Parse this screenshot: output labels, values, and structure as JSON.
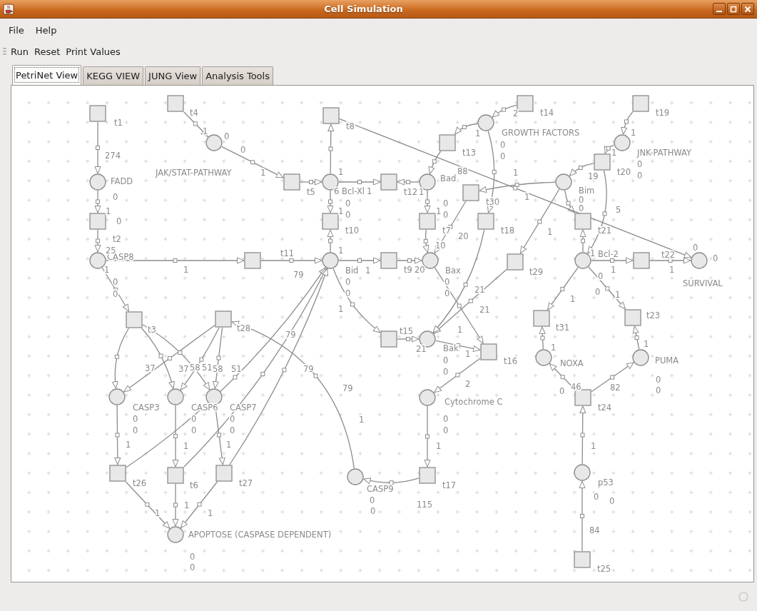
{
  "window": {
    "title": "Cell Simulation"
  },
  "menu": [
    "File",
    "Help"
  ],
  "toolbar": [
    "Run",
    "Reset",
    "Print Values"
  ],
  "tabs": [
    {
      "label": "PetriNet View",
      "selected": true
    },
    {
      "label": "KEGG VIEW",
      "selected": false
    },
    {
      "label": "JUNG View",
      "selected": false
    },
    {
      "label": "Analysis Tools",
      "selected": false
    }
  ],
  "petri_net": {
    "places": [
      {
        "name": "FADD",
        "tokens": [
          "0",
          "0"
        ]
      },
      {
        "name": "JAK/STAT-PATHWAY",
        "tokens": [
          "0",
          "0"
        ]
      },
      {
        "name": "CASP8",
        "tokens": [
          "0",
          "0"
        ]
      },
      {
        "name": "Bcl-Xl",
        "tokens": [
          "0",
          "0"
        ]
      },
      {
        "name": "Bad",
        "tokens": [
          "0",
          "0"
        ]
      },
      {
        "name": "GROWTH FACTORS",
        "tokens": [
          "0",
          "0"
        ]
      },
      {
        "name": "Bid",
        "tokens": [
          "0",
          "0"
        ]
      },
      {
        "name": "Bax",
        "tokens": [
          "0",
          "0"
        ]
      },
      {
        "name": "JNK-PATHWAY",
        "tokens": [
          "0",
          "0"
        ]
      },
      {
        "name": "Bim",
        "tokens": [
          "0",
          "0"
        ]
      },
      {
        "name": "Bcl-2",
        "tokens": [
          "0",
          "0"
        ]
      },
      {
        "name": "SURVIVAL",
        "tokens": [
          "0",
          "0"
        ]
      },
      {
        "name": "CASP3",
        "tokens": [
          "0",
          "0"
        ]
      },
      {
        "name": "CASP6",
        "tokens": [
          "0",
          "0"
        ]
      },
      {
        "name": "CASP7",
        "tokens": [
          "0",
          "0"
        ]
      },
      {
        "name": "APOPTOSE (CASPASE DEPENDENT)",
        "tokens": [
          "0",
          "0"
        ]
      },
      {
        "name": "Bak",
        "tokens": [
          "0",
          "0"
        ]
      },
      {
        "name": "Cytochrome C",
        "tokens": [
          "0",
          "0"
        ]
      },
      {
        "name": "CASP9",
        "tokens": [
          "0",
          "0"
        ]
      },
      {
        "name": "NOXA",
        "tokens": [
          "0"
        ]
      },
      {
        "name": "PUMA",
        "tokens": [
          "0",
          "0"
        ]
      },
      {
        "name": "p53",
        "tokens": [
          "0",
          "0"
        ]
      }
    ],
    "transitions": [
      "t1",
      "t4",
      "t8",
      "t14",
      "t19",
      "t13",
      "t20",
      "t5",
      "t12",
      "t30",
      "t2",
      "t10",
      "t7",
      "t18",
      "t21",
      "t11",
      "t9",
      "t22",
      "t29",
      "t3",
      "t28",
      "t31",
      "t23",
      "t15",
      "t16",
      "t26",
      "t6",
      "t27",
      "t17",
      "t24",
      "t25"
    ],
    "arc_weights": [
      "274",
      "1",
      "1",
      "25",
      "1",
      "1",
      "79",
      "1",
      "1",
      "6",
      "1",
      "1",
      "1",
      "1",
      "1",
      "1",
      "88",
      "1",
      "1",
      "10",
      "20",
      "20",
      "21",
      "21",
      "1",
      "2",
      "1",
      "1",
      "1",
      "1",
      "19",
      "5",
      "1",
      "1",
      "1",
      "1",
      "1",
      "1",
      "37",
      "37",
      "58",
      "51",
      "58",
      "51",
      "1",
      "1",
      "1",
      "1",
      "1",
      "1",
      "79",
      "79",
      "79",
      "1",
      "21",
      "1",
      "2",
      "1",
      "115",
      "1",
      "46",
      "82",
      "1",
      "1",
      "84"
    ]
  }
}
